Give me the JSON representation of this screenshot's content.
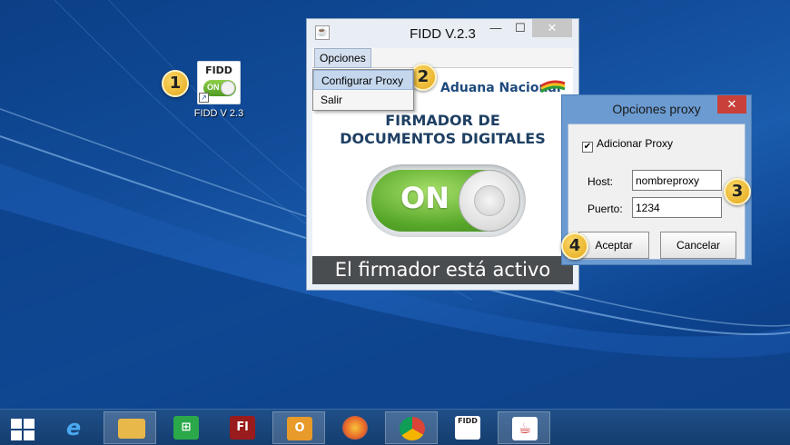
{
  "desktop": {
    "icon_caption": "FIDD V 2.3",
    "icon_title": "FIDD",
    "icon_toggle": "ON"
  },
  "steps": [
    "1",
    "2",
    "3",
    "4"
  ],
  "main_window": {
    "title": "FIDD V.2.3",
    "controls": {
      "minimize": "—",
      "maximize": "☐",
      "close": "✕"
    },
    "menu": {
      "label": "Opciones",
      "items": [
        "Configurar Proxy",
        "Salir"
      ]
    },
    "brand": "Aduana Nacional",
    "headline_line1": "FIRMADOR DE",
    "headline_line2": "DOCUMENTOS DIGITALES",
    "toggle_label": "ON",
    "status": "El firmador está activo"
  },
  "proxy_dialog": {
    "title": "Opciones proxy",
    "close": "✕",
    "checkbox_label": "Adicionar Proxy",
    "checkbox_checked": true,
    "check_mark": "✔",
    "host_label": "Host:",
    "host_value": "nombreproxy",
    "port_label": "Puerto:",
    "port_value": "1234",
    "accept_label": "Aceptar",
    "cancel_label": "Cancelar"
  },
  "taskbar": {
    "apps": [
      {
        "name": "start",
        "icon": "windows-logo"
      },
      {
        "name": "internet-explorer",
        "glyph": "e",
        "color": "#2a8ad8"
      },
      {
        "name": "file-explorer",
        "glyph": "",
        "color": "#e8b84a"
      },
      {
        "name": "store",
        "glyph": "⊞",
        "color": "#2aa84a"
      },
      {
        "name": "flash",
        "glyph": "Fl",
        "color": "#9a1b1b"
      },
      {
        "name": "outlook",
        "glyph": "O",
        "color": "#e89a2a"
      },
      {
        "name": "firefox",
        "glyph": "",
        "color": "#e8642a"
      },
      {
        "name": "chrome",
        "glyph": "",
        "color": "#4a9ad8"
      },
      {
        "name": "fidd",
        "glyph": "FIDD",
        "color": "#ffffff"
      },
      {
        "name": "java",
        "glyph": "☕",
        "color": "#ffffff"
      }
    ]
  }
}
